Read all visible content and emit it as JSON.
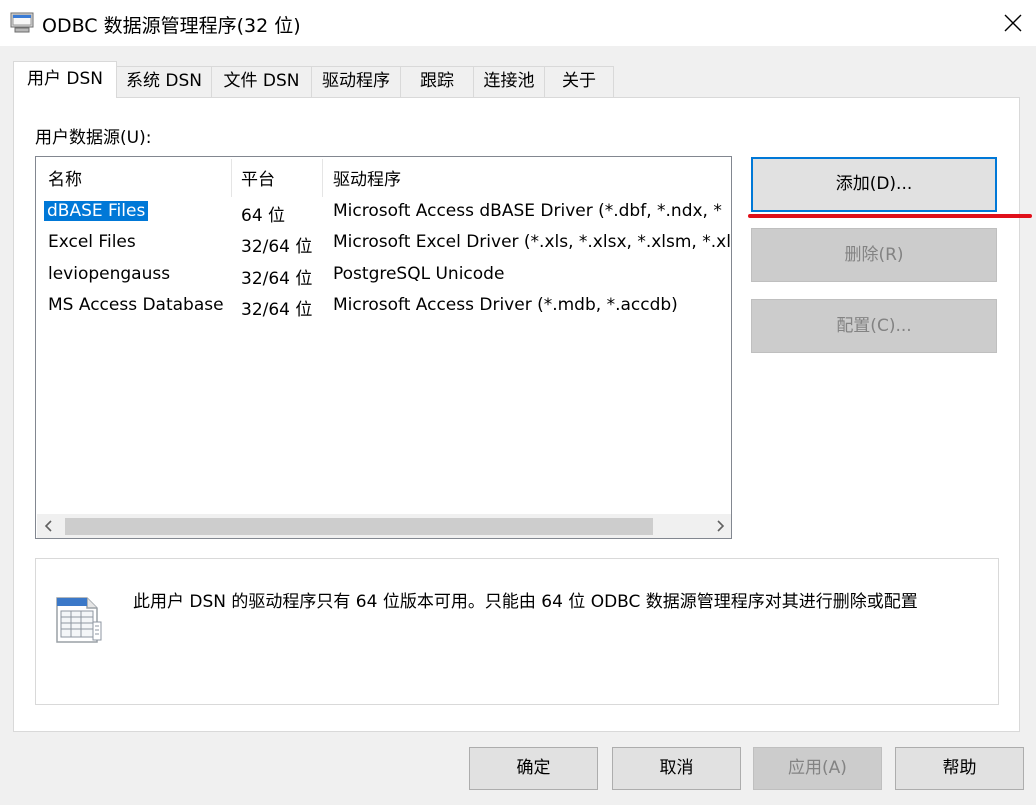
{
  "window": {
    "title": "ODBC 数据源管理程序(32 位)"
  },
  "tabs": [
    {
      "label": "用户 DSN",
      "active": true
    },
    {
      "label": "系统 DSN",
      "active": false
    },
    {
      "label": "文件 DSN",
      "active": false
    },
    {
      "label": "驱动程序",
      "active": false
    },
    {
      "label": "跟踪",
      "active": false
    },
    {
      "label": "连接池",
      "active": false
    },
    {
      "label": "关于",
      "active": false
    }
  ],
  "user_dsn": {
    "section_label": "用户数据源(U):",
    "columns": [
      "名称",
      "平台",
      "驱动程序"
    ],
    "rows": [
      {
        "name": "dBASE Files",
        "platform": "64 位",
        "driver": "Microsoft Access dBASE Driver (*.dbf, *.ndx, *",
        "selected": true
      },
      {
        "name": "Excel Files",
        "platform": "32/64 位",
        "driver": "Microsoft Excel Driver (*.xls, *.xlsx, *.xlsm, *.xls",
        "selected": false
      },
      {
        "name": "leviopengauss",
        "platform": "32/64 位",
        "driver": "PostgreSQL Unicode",
        "selected": false
      },
      {
        "name": "MS Access Database",
        "platform": "32/64 位",
        "driver": "Microsoft Access Driver (*.mdb, *.accdb)",
        "selected": false
      }
    ]
  },
  "side_buttons": {
    "add": "添加(D)...",
    "remove": "删除(R)",
    "configure": "配置(C)..."
  },
  "info": {
    "text": "此用户 DSN 的驱动程序只有 64 位版本可用。只能由 64 位 ODBC 数据源管理程序对其进行删除或配置"
  },
  "footer_buttons": {
    "ok": "确定",
    "cancel": "取消",
    "apply": "应用(A)",
    "help": "帮助"
  },
  "colors": {
    "selection": "#0078d7",
    "annotation_underline": "#e0101a"
  }
}
